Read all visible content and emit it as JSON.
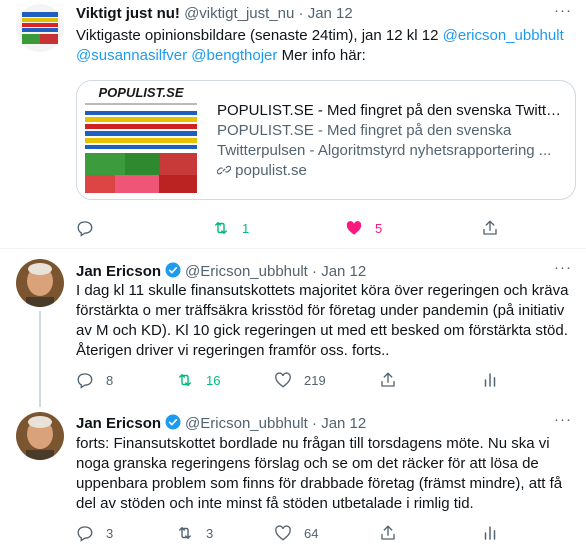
{
  "tweets": [
    {
      "name": "Viktigt just nu!",
      "handle": "@viktigt_just_nu",
      "sep": " · ",
      "date": "Jan 12",
      "text_a": "Viktigaste opinionsbildare (senaste 24tim), jan 12 kl 12 ",
      "mention1": "@ericson_ubbhult",
      "mention2": "@susannasilfver",
      "mention3": "@bengthojer",
      "text_b": "  Mer info här:",
      "card": {
        "logo": "POPULIST.SE",
        "title": "POPULIST.SE - Med fingret på den svenska Twitterp...",
        "desc1": "POPULIST.SE - Med fingret på den svenska",
        "desc2": "Twitterpulsen - Algoritmstyrd nyhetsrapportering ...",
        "domain": "populist.se"
      },
      "retweets": "1",
      "likes": "5"
    },
    {
      "name": "Jan Ericson",
      "handle": "@Ericson_ubbhult",
      "sep": " · ",
      "date": "Jan 12",
      "text": "I dag kl 11 skulle finansutskottets majoritet köra över regeringen och kräva förstärkta o mer träffsäkra krisstöd för företag under pandemin (på initiativ av M och KD).  Kl 10 gick regeringen ut med ett besked om förstärkta stöd. Återigen driver vi regeringen framför oss. forts..",
      "replies": "8",
      "retweets": "16",
      "likes": "219"
    },
    {
      "name": "Jan Ericson",
      "handle": "@Ericson_ubbhult",
      "sep": " · ",
      "date": "Jan 12",
      "text": "forts: Finansutskottet bordlade nu frågan till torsdagens möte. Nu ska vi noga granska regeringens förslag och se om det räcker för att lösa de uppenbara problem som finns för drabbade företag (främst mindre), att få del av stöden och inte minst få stöden utbetalade i rimlig tid.",
      "replies": "3",
      "retweets": "3",
      "likes": "64"
    }
  ],
  "colors": {
    "accent": "#1d9bf0",
    "retweet": "#00ba7c",
    "like": "#f91880",
    "muted": "#536471"
  }
}
